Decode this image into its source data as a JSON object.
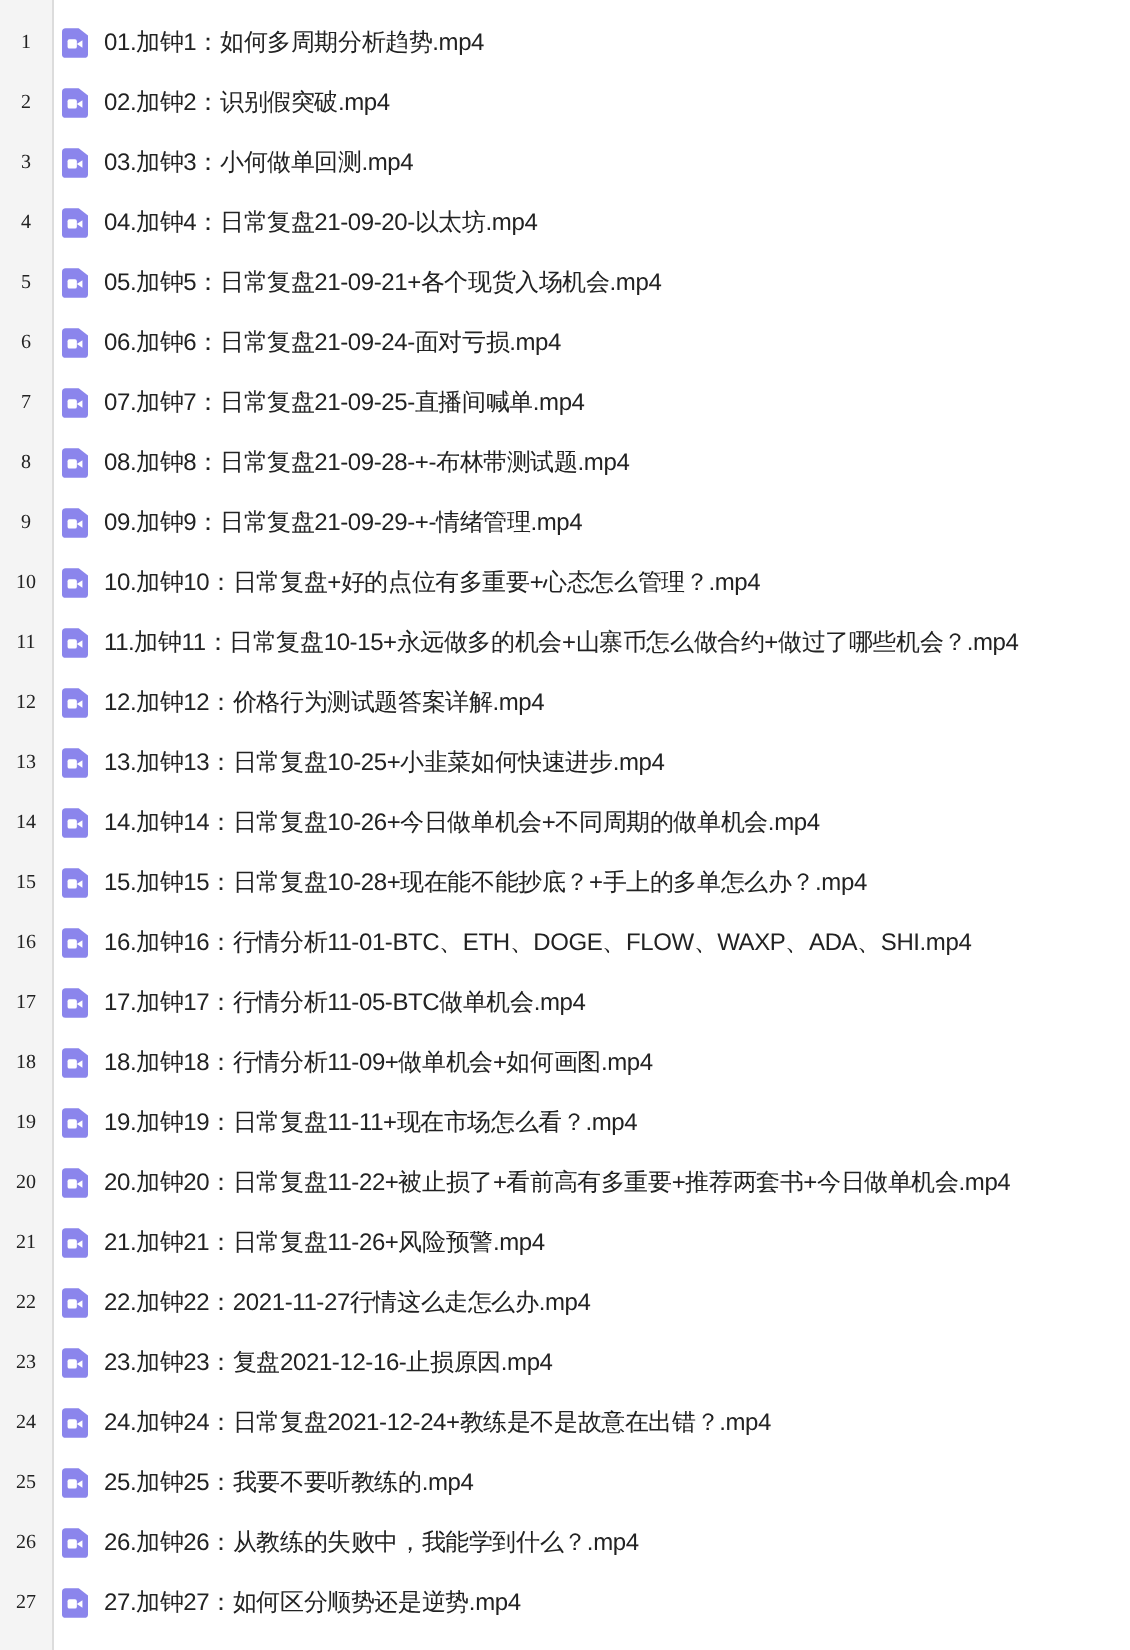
{
  "files": [
    {
      "number": "1",
      "name": "01.加钟1：如何多周期分析趋势.mp4"
    },
    {
      "number": "2",
      "name": "02.加钟2：识别假突破.mp4"
    },
    {
      "number": "3",
      "name": "03.加钟3：小何做单回测.mp4"
    },
    {
      "number": "4",
      "name": "04.加钟4：日常复盘21-09-20-以太坊.mp4"
    },
    {
      "number": "5",
      "name": "05.加钟5：日常复盘21-09-21+各个现货入场机会.mp4"
    },
    {
      "number": "6",
      "name": "06.加钟6：日常复盘21-09-24-面对亏损.mp4"
    },
    {
      "number": "7",
      "name": "07.加钟7：日常复盘21-09-25-直播间喊单.mp4"
    },
    {
      "number": "8",
      "name": "08.加钟8：日常复盘21-09-28-+-布林带测试题.mp4"
    },
    {
      "number": "9",
      "name": "09.加钟9：日常复盘21-09-29-+-情绪管理.mp4"
    },
    {
      "number": "10",
      "name": "10.加钟10：日常复盘+好的点位有多重要+心态怎么管理？.mp4"
    },
    {
      "number": "11",
      "name": "11.加钟11：日常复盘10-15+永远做多的机会+山寨币怎么做合约+做过了哪些机会？.mp4"
    },
    {
      "number": "12",
      "name": "12.加钟12：价格行为测试题答案详解.mp4"
    },
    {
      "number": "13",
      "name": "13.加钟13：日常复盘10-25+小韭菜如何快速进步.mp4"
    },
    {
      "number": "14",
      "name": "14.加钟14：日常复盘10-26+今日做单机会+不同周期的做单机会.mp4"
    },
    {
      "number": "15",
      "name": "15.加钟15：日常复盘10-28+现在能不能抄底？+手上的多单怎么办？.mp4"
    },
    {
      "number": "16",
      "name": "16.加钟16：行情分析11-01-BTC、ETH、DOGE、FLOW、WAXP、ADA、SHI.mp4"
    },
    {
      "number": "17",
      "name": "17.加钟17：行情分析11-05-BTC做单机会.mp4"
    },
    {
      "number": "18",
      "name": "18.加钟18：行情分析11-09+做单机会+如何画图.mp4"
    },
    {
      "number": "19",
      "name": "19.加钟19：日常复盘11-11+现在市场怎么看？.mp4"
    },
    {
      "number": "20",
      "name": "20.加钟20：日常复盘11-22+被止损了+看前高有多重要+推荐两套书+今日做单机会.mp4"
    },
    {
      "number": "21",
      "name": "21.加钟21：日常复盘11-26+风险预警.mp4"
    },
    {
      "number": "22",
      "name": "22.加钟22：2021-11-27行情这么走怎么办.mp4"
    },
    {
      "number": "23",
      "name": "23.加钟23：复盘2021-12-16-止损原因.mp4"
    },
    {
      "number": "24",
      "name": "24.加钟24：日常复盘2021-12-24+教练是不是故意在出错？.mp4"
    },
    {
      "number": "25",
      "name": "25.加钟25：我要不要听教练的.mp4"
    },
    {
      "number": "26",
      "name": "26.加钟26：从教练的失败中，我能学到什么？.mp4"
    },
    {
      "number": "27",
      "name": "27.加钟27：如何区分顺势还是逆势.mp4"
    }
  ]
}
